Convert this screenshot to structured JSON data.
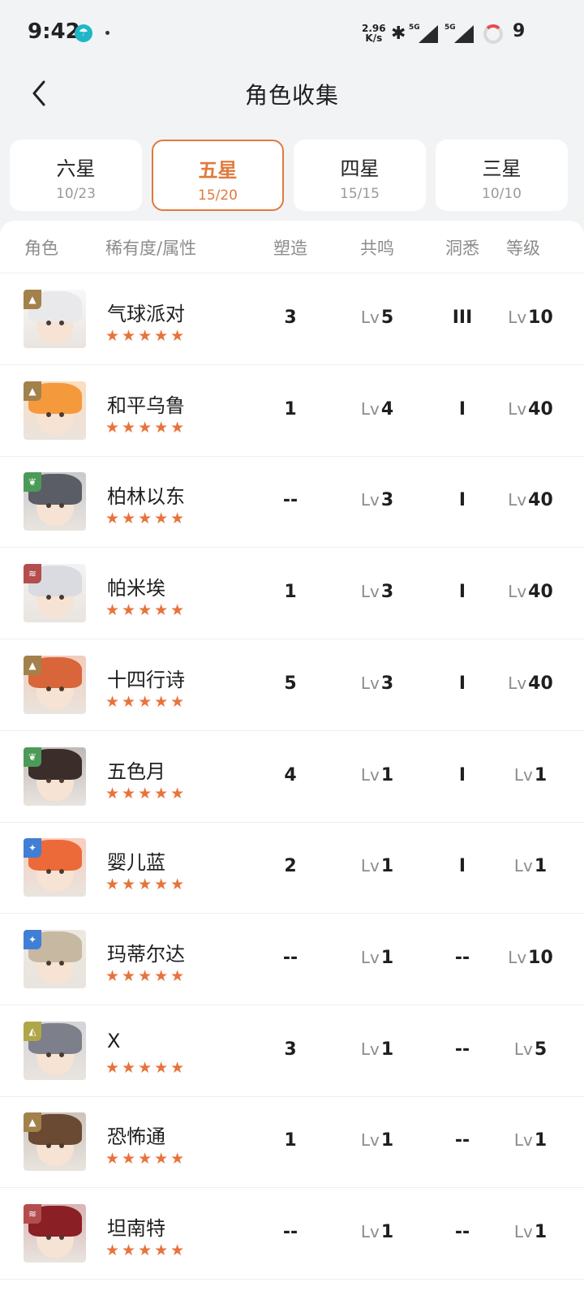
{
  "status_bar": {
    "time": "9:42",
    "net_speed_value": "2.96",
    "net_speed_unit": "K/s",
    "signal1_label": "5G",
    "signal2_label": "5G",
    "battery": "9"
  },
  "header": {
    "title": "角色收集"
  },
  "tabs": [
    {
      "label": "六星",
      "count": "10/23",
      "active": false
    },
    {
      "label": "五星",
      "count": "15/20",
      "active": true
    },
    {
      "label": "四星",
      "count": "15/15",
      "active": false
    },
    {
      "label": "三星",
      "count": "10/10",
      "active": false
    }
  ],
  "table": {
    "columns": {
      "role": "角色",
      "rarity": "稀有度/属性",
      "shape": "塑造",
      "resonance": "共鸣",
      "insight": "洞悉",
      "level": "等级"
    },
    "lv_prefix": "Lv",
    "stars": "★★★★★",
    "rows": [
      {
        "name": "气球派对",
        "shape": "3",
        "resonance": "5",
        "insight": "III",
        "level": "10",
        "attr_color": "#a2814a",
        "attr_icon": "mountain-icon",
        "hair": "#e9e9ec"
      },
      {
        "name": "和平乌鲁",
        "shape": "1",
        "resonance": "4",
        "insight": "I",
        "level": "40",
        "attr_color": "#a2814a",
        "attr_icon": "mountain-icon",
        "hair": "#f59a3c"
      },
      {
        "name": "柏林以东",
        "shape": "--",
        "resonance": "3",
        "insight": "I",
        "level": "40",
        "attr_color": "#4c9a57",
        "attr_icon": "leaf-icon",
        "hair": "#5b5d66"
      },
      {
        "name": "帕米埃",
        "shape": "1",
        "resonance": "3",
        "insight": "I",
        "level": "40",
        "attr_color": "#b44d4d",
        "attr_icon": "wave-icon",
        "hair": "#d9dbe0"
      },
      {
        "name": "十四行诗",
        "shape": "5",
        "resonance": "3",
        "insight": "I",
        "level": "40",
        "attr_color": "#a2814a",
        "attr_icon": "mountain-icon",
        "hair": "#d8663a"
      },
      {
        "name": "五色月",
        "shape": "4",
        "resonance": "1",
        "insight": "I",
        "level": "1",
        "attr_color": "#4c9a57",
        "attr_icon": "leaf-icon",
        "hair": "#3b2d2a"
      },
      {
        "name": "婴儿蓝",
        "shape": "2",
        "resonance": "1",
        "insight": "I",
        "level": "1",
        "attr_color": "#3f7fd6",
        "attr_icon": "star-icon",
        "hair": "#ec6a3a"
      },
      {
        "name": "玛蒂尔达",
        "shape": "--",
        "resonance": "1",
        "insight": "--",
        "level": "10",
        "attr_color": "#3f7fd6",
        "attr_icon": "star-icon",
        "hair": "#c7b8a2"
      },
      {
        "name": "X",
        "shape": "3",
        "resonance": "1",
        "insight": "--",
        "level": "5",
        "attr_color": "#b1a54a",
        "attr_icon": "pyramid-icon",
        "hair": "#7d7f8a"
      },
      {
        "name": "恐怖通",
        "shape": "1",
        "resonance": "1",
        "insight": "--",
        "level": "1",
        "attr_color": "#a2814a",
        "attr_icon": "mountain-icon",
        "hair": "#6a4a33"
      },
      {
        "name": "坦南特",
        "shape": "--",
        "resonance": "1",
        "insight": "--",
        "level": "1",
        "attr_color": "#b44d4d",
        "attr_icon": "wave-icon",
        "hair": "#8a1f25"
      }
    ]
  }
}
